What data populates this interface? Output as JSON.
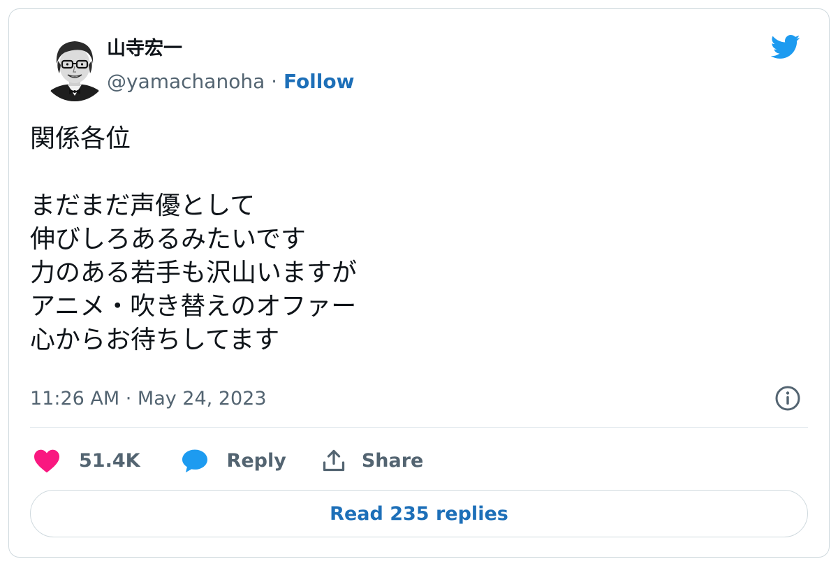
{
  "author": {
    "display_name": "山寺宏一",
    "handle": "@yamachanoha",
    "separator": " · ",
    "follow_label": "Follow"
  },
  "tweet": {
    "text": "関係各位\n\nまだまだ声優として\n伸びしろあるみたいです\n力のある若手も沢山いますが\nアニメ・吹き替えのオファー\n心からお待ちしてます",
    "timestamp": "11:26 AM · May 24, 2023"
  },
  "actions": {
    "like_count": "51.4K",
    "reply_label": "Reply",
    "share_label": "Share"
  },
  "read_replies_label": "Read 235 replies",
  "colors": {
    "accent": "#1d6fb8",
    "twitter_blue": "#1d9bf0",
    "like_pink": "#f91880",
    "muted_text": "#536471",
    "border": "#cfd9de"
  },
  "icons": {
    "logo": "twitter-bird-icon",
    "info": "info-icon",
    "like": "heart-icon",
    "reply": "speech-bubble-icon",
    "share": "share-upload-icon"
  }
}
